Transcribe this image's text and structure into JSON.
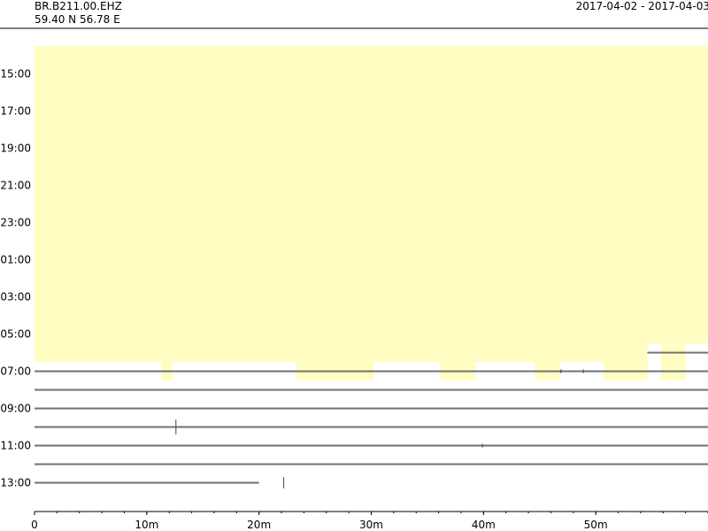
{
  "header": {
    "station": "BR.B211.00.EHZ",
    "coordinates": "59.40 N 56.78 E",
    "date_range": "2017-04-02 - 2017-04-03"
  },
  "chart_data": {
    "type": "dayplot",
    "title": "",
    "xlabel": "",
    "ylabel": "",
    "x_unit": "minutes",
    "xlim": [
      0,
      60
    ],
    "x_major_ticks": [
      0,
      10,
      20,
      30,
      40,
      50
    ],
    "x_tick_labels": [
      "0",
      "10m",
      "20m",
      "30m",
      "40m",
      "50m"
    ],
    "x_minor_step": 2,
    "y_tick_labels": [
      "15:00",
      "17:00",
      "19:00",
      "21:00",
      "23:00",
      "01:00",
      "03:00",
      "05:00",
      "07:00",
      "09:00",
      "11:00",
      "13:00"
    ],
    "rows": [
      "14:00",
      "15:00",
      "16:00",
      "17:00",
      "18:00",
      "19:00",
      "20:00",
      "21:00",
      "22:00",
      "23:00",
      "00:00",
      "01:00",
      "02:00",
      "03:00",
      "04:00",
      "05:00",
      "06:00",
      "07:00",
      "08:00",
      "09:00",
      "10:00",
      "11:00",
      "12:00",
      "13:00"
    ],
    "gap_color": "#fffdc2",
    "trace_color": "#707070",
    "data_gaps": [
      {
        "from_row": 0,
        "to_row": 15,
        "start_min": 0,
        "end_min": 60
      },
      {
        "from_row": 15,
        "to_row": 15,
        "start_min": 54.6,
        "end_min": 60
      },
      {
        "from_row": 16,
        "to_row": 16,
        "start_min": 0,
        "end_min": 54.6
      },
      {
        "from_row": 17,
        "to_row": 17,
        "start_min": 11.3,
        "end_min": 12.3
      },
      {
        "from_row": 17,
        "to_row": 17,
        "start_min": 23.3,
        "end_min": 30.2
      },
      {
        "from_row": 17,
        "to_row": 17,
        "start_min": 36.1,
        "end_min": 39.3
      },
      {
        "from_row": 17,
        "to_row": 17,
        "start_min": 44.6,
        "end_min": 46.8
      },
      {
        "from_row": 17,
        "to_row": 17,
        "start_min": 50.7,
        "end_min": 54.6
      },
      {
        "from_row": 16,
        "to_row": 16,
        "start_min": 55.8,
        "end_min": 58.0
      },
      {
        "from_row": 17,
        "to_row": 17,
        "start_min": 55.8,
        "end_min": 58.0
      }
    ],
    "traces": [
      {
        "row": 16,
        "start_min": 54.6,
        "end_min": 60
      },
      {
        "row": 17,
        "start_min": 0,
        "end_min": 60
      },
      {
        "row": 18,
        "start_min": 0,
        "end_min": 60
      },
      {
        "row": 19,
        "start_min": 0,
        "end_min": 60
      },
      {
        "row": 20,
        "start_min": 0,
        "end_min": 60
      },
      {
        "row": 21,
        "start_min": 0,
        "end_min": 60
      },
      {
        "row": 22,
        "start_min": 0,
        "end_min": 60
      },
      {
        "row": 23,
        "start_min": 0,
        "end_min": 20
      }
    ],
    "events": [
      {
        "row": 17,
        "minute": 46.9,
        "amplitude": 0.1
      },
      {
        "row": 17,
        "minute": 48.9,
        "amplitude": 0.1
      },
      {
        "row": 20,
        "minute": 12.6,
        "amplitude": 0.4
      },
      {
        "row": 21,
        "minute": 39.9,
        "amplitude": 0.1
      },
      {
        "row": 23,
        "minute": 22.2,
        "amplitude": 0.3
      }
    ]
  }
}
